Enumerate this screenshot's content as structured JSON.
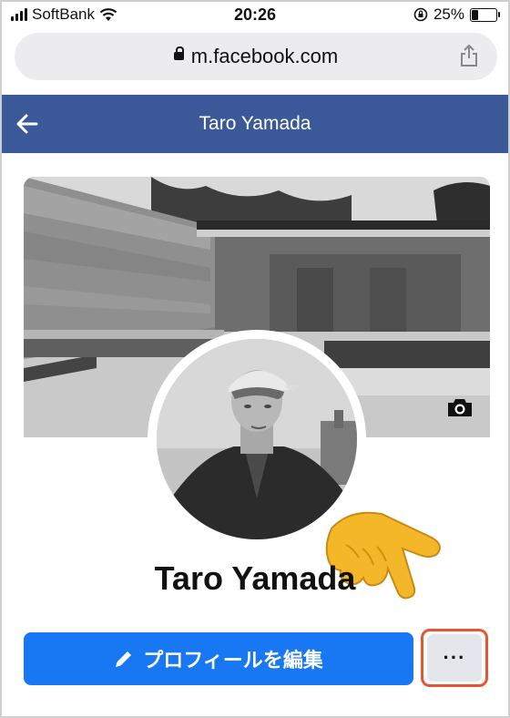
{
  "status_bar": {
    "carrier": "SoftBank",
    "time": "20:26",
    "battery_percent": "25%",
    "battery_level": 0.25,
    "icons": [
      "signal-bars-icon",
      "wifi-icon",
      "orientation-lock-icon",
      "battery-icon"
    ]
  },
  "browser": {
    "url": "m.facebook.com",
    "icons": [
      "lock-icon",
      "share-icon"
    ]
  },
  "header": {
    "title": "Taro Yamada",
    "background": "#3b5998",
    "back_icon": "back-arrow-icon"
  },
  "profile": {
    "name": "Taro Yamada",
    "cover_camera_icon": "camera-icon",
    "pointing_hand_icon": "pointing-hand-icon"
  },
  "actions": {
    "edit_profile_label": "プロフィールを編集",
    "edit_icon": "pencil-icon",
    "more_label": "···",
    "accent": "#1877f2",
    "highlight": "#e8542f"
  }
}
